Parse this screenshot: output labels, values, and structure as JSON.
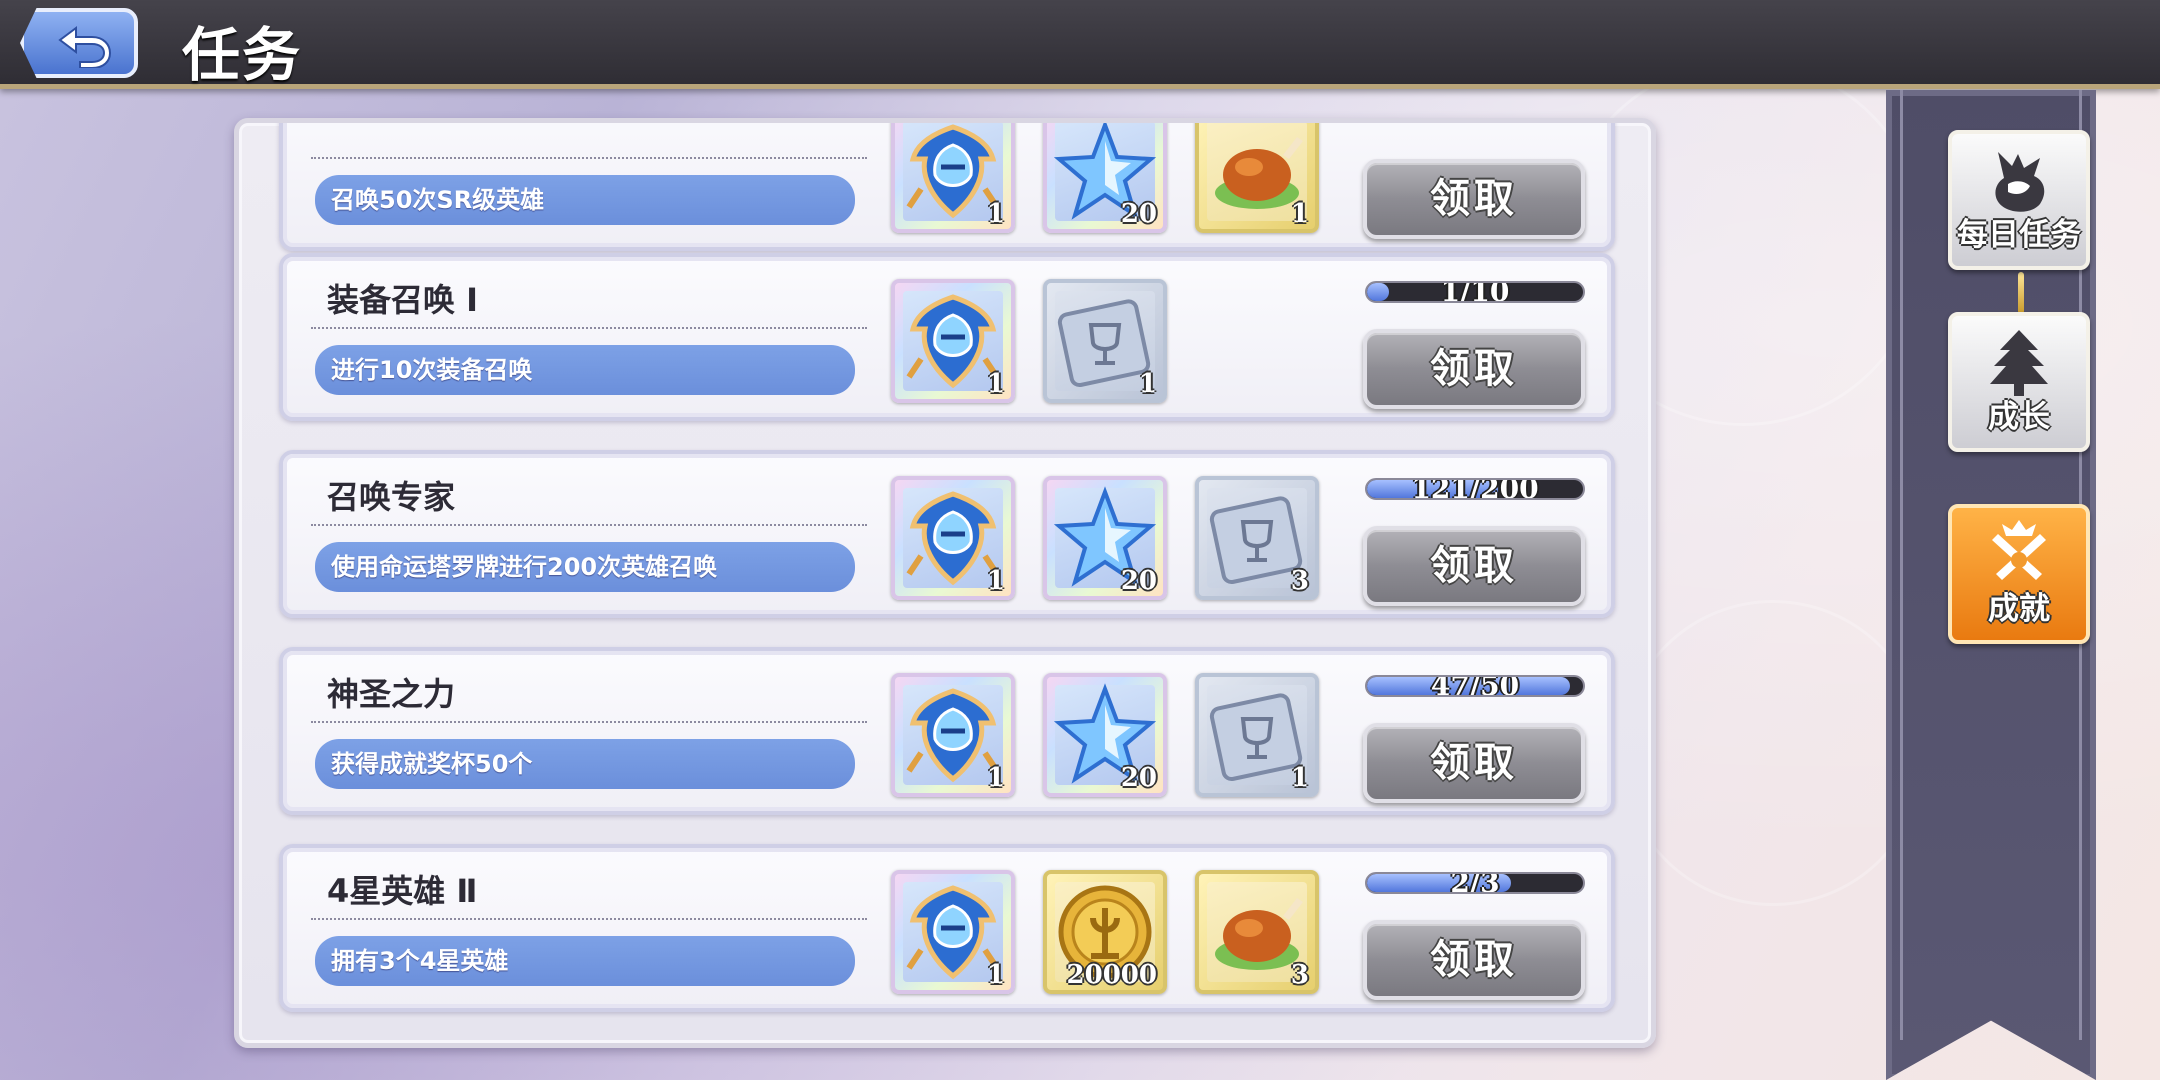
{
  "header": {
    "title": "任务"
  },
  "side_tabs": [
    {
      "label": "每日任务",
      "icon": "dragon-icon",
      "active": false
    },
    {
      "label": "成长",
      "icon": "tree-icon",
      "active": false
    },
    {
      "label": "成就",
      "icon": "crossed-swords-icon",
      "active": true
    }
  ],
  "quests": [
    {
      "title": "",
      "description": "召唤50次SR级英雄",
      "rewards": [
        {
          "icon": "hero-crest-icon",
          "frame": "rainbow",
          "count": "1"
        },
        {
          "icon": "star-icon",
          "frame": "rainbow",
          "count": "20"
        },
        {
          "icon": "roast-chicken-icon",
          "frame": "gold",
          "count": "1"
        }
      ],
      "progress_text": "",
      "progress": null,
      "button": "领取"
    },
    {
      "title": "装备召唤 Ⅰ",
      "description": "进行10次装备召唤",
      "rewards": [
        {
          "icon": "hero-crest-icon",
          "frame": "rainbow",
          "count": "1"
        },
        {
          "icon": "trophy-card-icon",
          "frame": "silver",
          "count": "1"
        }
      ],
      "progress_text": "1/10",
      "progress": 0.1,
      "button": "领取"
    },
    {
      "title": "召唤专家",
      "description": "使用命运塔罗牌进行200次英雄召唤",
      "rewards": [
        {
          "icon": "hero-crest-icon",
          "frame": "rainbow",
          "count": "1"
        },
        {
          "icon": "star-icon",
          "frame": "rainbow",
          "count": "20"
        },
        {
          "icon": "trophy-card-icon",
          "frame": "silver",
          "count": "3"
        }
      ],
      "progress_text": "121/200",
      "progress": 0.605,
      "button": "领取"
    },
    {
      "title": "神圣之力",
      "description": "获得成就奖杯50个",
      "rewards": [
        {
          "icon": "hero-crest-icon",
          "frame": "rainbow",
          "count": "1"
        },
        {
          "icon": "star-icon",
          "frame": "rainbow",
          "count": "20"
        },
        {
          "icon": "trophy-card-icon",
          "frame": "silver",
          "count": "1"
        }
      ],
      "progress_text": "47/50",
      "progress": 0.94,
      "button": "领取"
    },
    {
      "title": "4星英雄 Ⅱ",
      "description": "拥有3个4星英雄",
      "rewards": [
        {
          "icon": "hero-crest-icon",
          "frame": "rainbow",
          "count": "1"
        },
        {
          "icon": "gold-coin-icon",
          "frame": "gold",
          "count": "20000"
        },
        {
          "icon": "roast-chicken-icon",
          "frame": "gold",
          "count": "3"
        }
      ],
      "progress_text": "2/3",
      "progress": 0.667,
      "button": "领取"
    }
  ]
}
